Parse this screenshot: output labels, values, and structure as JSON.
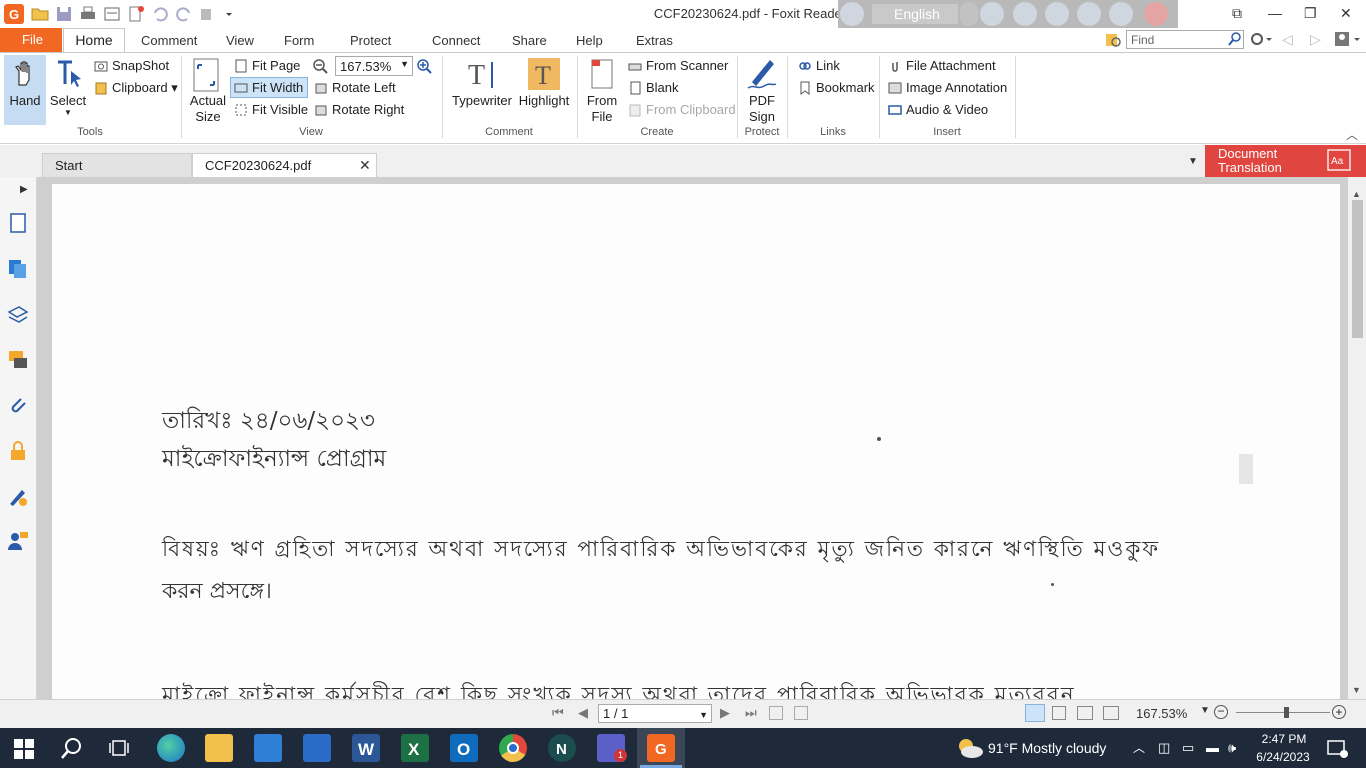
{
  "window": {
    "title": "CCF20230624.pdf - Foxit Reader",
    "language": "English",
    "controls": [
      "min",
      "restore",
      "close"
    ]
  },
  "menu": {
    "file": "File",
    "tabs": [
      "Home",
      "Comment",
      "View",
      "Form",
      "Protect",
      "Connect",
      "Share",
      "Help",
      "Extras"
    ],
    "find_placeholder": "Find"
  },
  "ribbon": {
    "tools": {
      "hand": "Hand",
      "select": "Select",
      "snapshot": "SnapShot",
      "clipboard": "Clipboard",
      "label": "Tools"
    },
    "view": {
      "actual_size": "Actual Size",
      "fit_page": "Fit Page",
      "fit_width": "Fit Width",
      "fit_visible": "Fit Visible",
      "zoom": "167.53%",
      "rotate_left": "Rotate Left",
      "rotate_right": "Rotate Right",
      "label": "View"
    },
    "comment": {
      "typewriter": "Typewriter",
      "highlight": "Highlight",
      "label": "Comment"
    },
    "create": {
      "from_file": "From File",
      "from_scanner": "From Scanner",
      "blank": "Blank",
      "from_clipboard": "From Clipboard",
      "label": "Create"
    },
    "protect": {
      "pdf_sign": "PDF Sign",
      "label": "Protect"
    },
    "links": {
      "link": "Link",
      "bookmark": "Bookmark",
      "label": "Links"
    },
    "insert": {
      "file_attachment": "File Attachment",
      "image_annotation": "Image Annotation",
      "audio_video": "Audio & Video",
      "label": "Insert"
    }
  },
  "tabs": {
    "start": "Start",
    "doc": "CCF20230624.pdf",
    "doc_translation_line1": "Document",
    "doc_translation_line2": "Translation"
  },
  "document": {
    "date_line": "তারিখঃ ২৪/০৬/২০২৩",
    "program_line": "মাইক্রোফাইন্যান্স প্রোগ্রাম",
    "subject_line1": "বিষয়ঃ ঋণ গ্রহিতা সদস্যের অথবা সদস্যের পারিবারিক অভিভাবকের মৃত্যু জনিত কারনে ঋণস্থিতি মওকুফ",
    "subject_line2": "করন প্রসঙ্গে।",
    "body_line1": "মাইক্রো ফাইনান্স কর্মসূচীর বেশ কিছু সংখ্যক সদস্য অথবা তাদের পারিবারিক অভিভাবক মৃত্যুবরন"
  },
  "status": {
    "page": "1 / 1",
    "zoom": "167.53%"
  },
  "taskbar": {
    "weather": "91°F  Mostly cloudy",
    "time": "2:47 PM",
    "date": "6/24/2023",
    "teams_badge": "1"
  },
  "colors": {
    "accent": "#f26722",
    "doc_translation": "#e0463f",
    "taskbar": "#1e2a3a"
  }
}
